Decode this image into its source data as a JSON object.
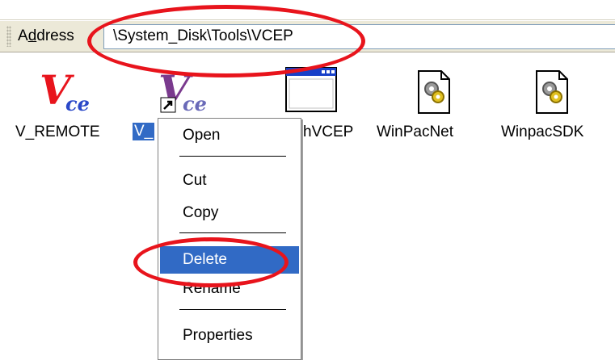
{
  "address_bar": {
    "label_before": "A",
    "label_underlined": "d",
    "label_after": "dress",
    "path": "\\System_Disk\\Tools\\VCEP"
  },
  "files": [
    {
      "name": "V_REMOTE",
      "icon": "vce-app-icon"
    },
    {
      "name": "V_",
      "icon": "vce-shortcut-icon",
      "selected": true
    },
    {
      "name": "hVCEP",
      "icon": "window-app-icon"
    },
    {
      "name": "WinPacNet",
      "icon": "config-file-icon"
    },
    {
      "name": "WinpacSDK",
      "icon": "config-file-icon"
    }
  ],
  "context_menu": {
    "items": [
      "Open",
      "Cut",
      "Copy",
      "Delete",
      "Rename",
      "Properties"
    ],
    "highlighted": "Delete"
  },
  "colors": {
    "selection": "#316ac5",
    "annotation": "#e8141c",
    "vce_red": "#e8141c",
    "vce_purple": "#7a3a8e"
  }
}
